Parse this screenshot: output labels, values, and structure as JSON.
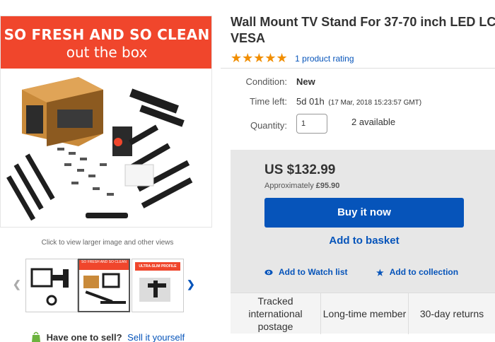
{
  "hero": {
    "banner_line1": "SO FRESH AND SO CLEAN",
    "banner_line2": "out the box",
    "view_larger": "Click to view larger image and other views"
  },
  "thumbnails": [
    {
      "caption": ""
    },
    {
      "caption": "SO FRESH AND SO CLEAN"
    },
    {
      "caption": "ULTRA-SLIM PROFILE"
    }
  ],
  "sell": {
    "question": "Have one to sell?",
    "link": "Sell it yourself"
  },
  "product": {
    "title_line1": "Wall Mount TV Stand For 37-70 inch LED LC",
    "title_line2": "VESA",
    "stars": "★★★★★",
    "rating_text": "1 product rating"
  },
  "details": {
    "condition_label": "Condition:",
    "condition_value": "New",
    "time_label": "Time left:",
    "time_value": "5d 01h",
    "time_detail": "(17 Mar, 2018  15:23:57 GMT)",
    "quantity_label": "Quantity:",
    "quantity_value": "1",
    "available": "2 available"
  },
  "buybox": {
    "price": "US $132.99",
    "approx_prefix": "Approximately",
    "approx_value": "£95.90",
    "buy_now": "Buy it now",
    "add_basket": "Add to basket",
    "watch_list": "Add to Watch list",
    "collection": "Add to collection"
  },
  "badges": [
    "Tracked international postage",
    "Long-time member",
    "30-day returns"
  ],
  "colors": {
    "banner": "#f0462c",
    "link_blue": "#0654ba",
    "star_orange": "#f18e00",
    "buybox_bg": "#e7e7e7"
  },
  "icons": {
    "watch": "eye-icon",
    "collection": "star-icon",
    "sell": "bag-icon",
    "prev": "chevron-left-icon",
    "next": "chevron-right-icon"
  }
}
